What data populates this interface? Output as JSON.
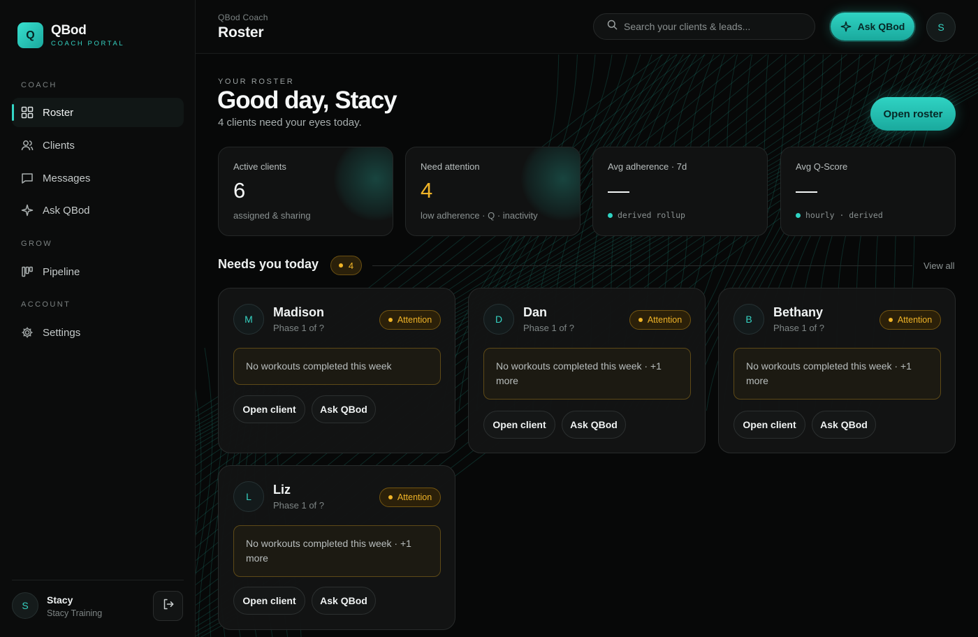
{
  "brand": {
    "name": "QBod",
    "subtitle": "COACH PORTAL",
    "logo_letter": "Q"
  },
  "sidebar": {
    "sections": [
      {
        "label": "COACH"
      },
      {
        "label": "GROW"
      },
      {
        "label": "ACCOUNT"
      }
    ],
    "items": [
      {
        "label": "Roster",
        "icon": "grid-icon",
        "active": true
      },
      {
        "label": "Clients",
        "icon": "users-icon"
      },
      {
        "label": "Messages",
        "icon": "message-icon"
      },
      {
        "label": "Ask QBod",
        "icon": "sparkle-icon"
      },
      {
        "label": "Pipeline",
        "icon": "pipeline-icon"
      },
      {
        "label": "Settings",
        "icon": "gear-icon"
      }
    ],
    "user": {
      "initial": "S",
      "name": "Stacy",
      "org": "Stacy Training"
    }
  },
  "topbar": {
    "breadcrumb": "QBod Coach",
    "title": "Roster",
    "search_placeholder": "Search your clients & leads...",
    "ask_label": "Ask QBod",
    "avatar_initial": "S"
  },
  "hero": {
    "eyebrow": "YOUR ROSTER",
    "greeting": "Good day, Stacy",
    "subtitle": "4 clients need your eyes today.",
    "cta": "Open roster"
  },
  "stats": [
    {
      "label": "Active clients",
      "value": "6",
      "note": "assigned & sharing"
    },
    {
      "label": "Need attention",
      "value": "4",
      "note": "low adherence · Q · inactivity"
    },
    {
      "label": "Avg adherence · 7d",
      "value": "—",
      "note": "derived rollup"
    },
    {
      "label": "Avg Q-Score",
      "value": "—",
      "note": "hourly · derived"
    }
  ],
  "needs_section": {
    "title": "Needs you today",
    "count": "4",
    "view_all": "View all"
  },
  "clients": [
    {
      "initial": "M",
      "name": "Madison",
      "phase": "Phase 1 of ?",
      "badge": "Attention",
      "alert": "No workouts completed this week",
      "open_label": "Open client",
      "ask_label": "Ask QBod"
    },
    {
      "initial": "D",
      "name": "Dan",
      "phase": "Phase 1 of ?",
      "badge": "Attention",
      "alert": "No workouts completed this week · +1 more",
      "open_label": "Open client",
      "ask_label": "Ask QBod"
    },
    {
      "initial": "B",
      "name": "Bethany",
      "phase": "Phase 1 of ?",
      "badge": "Attention",
      "alert": "No workouts completed this week · +1 more",
      "open_label": "Open client",
      "ask_label": "Ask QBod"
    },
    {
      "initial": "L",
      "name": "Liz",
      "phase": "Phase 1 of ?",
      "badge": "Attention",
      "alert": "No workouts completed this week · +1 more",
      "open_label": "Open client",
      "ask_label": "Ask QBod"
    }
  ],
  "colors": {
    "accent": "#2fd3c3",
    "warning": "#f0b428",
    "background": "#070808",
    "surface": "#111212"
  }
}
